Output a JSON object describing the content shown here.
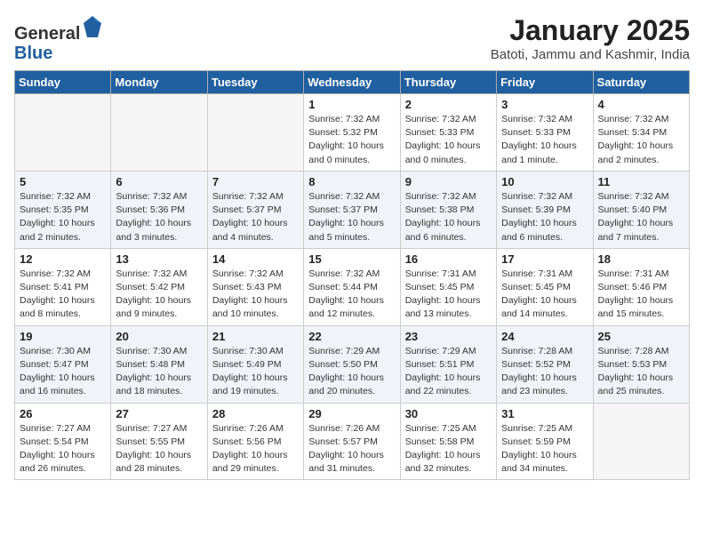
{
  "header": {
    "logo_general": "General",
    "logo_blue": "Blue",
    "month_title": "January 2025",
    "location": "Batoti, Jammu and Kashmir, India"
  },
  "weekdays": [
    "Sunday",
    "Monday",
    "Tuesday",
    "Wednesday",
    "Thursday",
    "Friday",
    "Saturday"
  ],
  "weeks": [
    [
      {
        "day": "",
        "info": ""
      },
      {
        "day": "",
        "info": ""
      },
      {
        "day": "",
        "info": ""
      },
      {
        "day": "1",
        "info": "Sunrise: 7:32 AM\nSunset: 5:32 PM\nDaylight: 10 hours\nand 0 minutes."
      },
      {
        "day": "2",
        "info": "Sunrise: 7:32 AM\nSunset: 5:33 PM\nDaylight: 10 hours\nand 0 minutes."
      },
      {
        "day": "3",
        "info": "Sunrise: 7:32 AM\nSunset: 5:33 PM\nDaylight: 10 hours\nand 1 minute."
      },
      {
        "day": "4",
        "info": "Sunrise: 7:32 AM\nSunset: 5:34 PM\nDaylight: 10 hours\nand 2 minutes."
      }
    ],
    [
      {
        "day": "5",
        "info": "Sunrise: 7:32 AM\nSunset: 5:35 PM\nDaylight: 10 hours\nand 2 minutes."
      },
      {
        "day": "6",
        "info": "Sunrise: 7:32 AM\nSunset: 5:36 PM\nDaylight: 10 hours\nand 3 minutes."
      },
      {
        "day": "7",
        "info": "Sunrise: 7:32 AM\nSunset: 5:37 PM\nDaylight: 10 hours\nand 4 minutes."
      },
      {
        "day": "8",
        "info": "Sunrise: 7:32 AM\nSunset: 5:37 PM\nDaylight: 10 hours\nand 5 minutes."
      },
      {
        "day": "9",
        "info": "Sunrise: 7:32 AM\nSunset: 5:38 PM\nDaylight: 10 hours\nand 6 minutes."
      },
      {
        "day": "10",
        "info": "Sunrise: 7:32 AM\nSunset: 5:39 PM\nDaylight: 10 hours\nand 6 minutes."
      },
      {
        "day": "11",
        "info": "Sunrise: 7:32 AM\nSunset: 5:40 PM\nDaylight: 10 hours\nand 7 minutes."
      }
    ],
    [
      {
        "day": "12",
        "info": "Sunrise: 7:32 AM\nSunset: 5:41 PM\nDaylight: 10 hours\nand 8 minutes."
      },
      {
        "day": "13",
        "info": "Sunrise: 7:32 AM\nSunset: 5:42 PM\nDaylight: 10 hours\nand 9 minutes."
      },
      {
        "day": "14",
        "info": "Sunrise: 7:32 AM\nSunset: 5:43 PM\nDaylight: 10 hours\nand 10 minutes."
      },
      {
        "day": "15",
        "info": "Sunrise: 7:32 AM\nSunset: 5:44 PM\nDaylight: 10 hours\nand 12 minutes."
      },
      {
        "day": "16",
        "info": "Sunrise: 7:31 AM\nSunset: 5:45 PM\nDaylight: 10 hours\nand 13 minutes."
      },
      {
        "day": "17",
        "info": "Sunrise: 7:31 AM\nSunset: 5:45 PM\nDaylight: 10 hours\nand 14 minutes."
      },
      {
        "day": "18",
        "info": "Sunrise: 7:31 AM\nSunset: 5:46 PM\nDaylight: 10 hours\nand 15 minutes."
      }
    ],
    [
      {
        "day": "19",
        "info": "Sunrise: 7:30 AM\nSunset: 5:47 PM\nDaylight: 10 hours\nand 16 minutes."
      },
      {
        "day": "20",
        "info": "Sunrise: 7:30 AM\nSunset: 5:48 PM\nDaylight: 10 hours\nand 18 minutes."
      },
      {
        "day": "21",
        "info": "Sunrise: 7:30 AM\nSunset: 5:49 PM\nDaylight: 10 hours\nand 19 minutes."
      },
      {
        "day": "22",
        "info": "Sunrise: 7:29 AM\nSunset: 5:50 PM\nDaylight: 10 hours\nand 20 minutes."
      },
      {
        "day": "23",
        "info": "Sunrise: 7:29 AM\nSunset: 5:51 PM\nDaylight: 10 hours\nand 22 minutes."
      },
      {
        "day": "24",
        "info": "Sunrise: 7:28 AM\nSunset: 5:52 PM\nDaylight: 10 hours\nand 23 minutes."
      },
      {
        "day": "25",
        "info": "Sunrise: 7:28 AM\nSunset: 5:53 PM\nDaylight: 10 hours\nand 25 minutes."
      }
    ],
    [
      {
        "day": "26",
        "info": "Sunrise: 7:27 AM\nSunset: 5:54 PM\nDaylight: 10 hours\nand 26 minutes."
      },
      {
        "day": "27",
        "info": "Sunrise: 7:27 AM\nSunset: 5:55 PM\nDaylight: 10 hours\nand 28 minutes."
      },
      {
        "day": "28",
        "info": "Sunrise: 7:26 AM\nSunset: 5:56 PM\nDaylight: 10 hours\nand 29 minutes."
      },
      {
        "day": "29",
        "info": "Sunrise: 7:26 AM\nSunset: 5:57 PM\nDaylight: 10 hours\nand 31 minutes."
      },
      {
        "day": "30",
        "info": "Sunrise: 7:25 AM\nSunset: 5:58 PM\nDaylight: 10 hours\nand 32 minutes."
      },
      {
        "day": "31",
        "info": "Sunrise: 7:25 AM\nSunset: 5:59 PM\nDaylight: 10 hours\nand 34 minutes."
      },
      {
        "day": "",
        "info": ""
      }
    ]
  ]
}
